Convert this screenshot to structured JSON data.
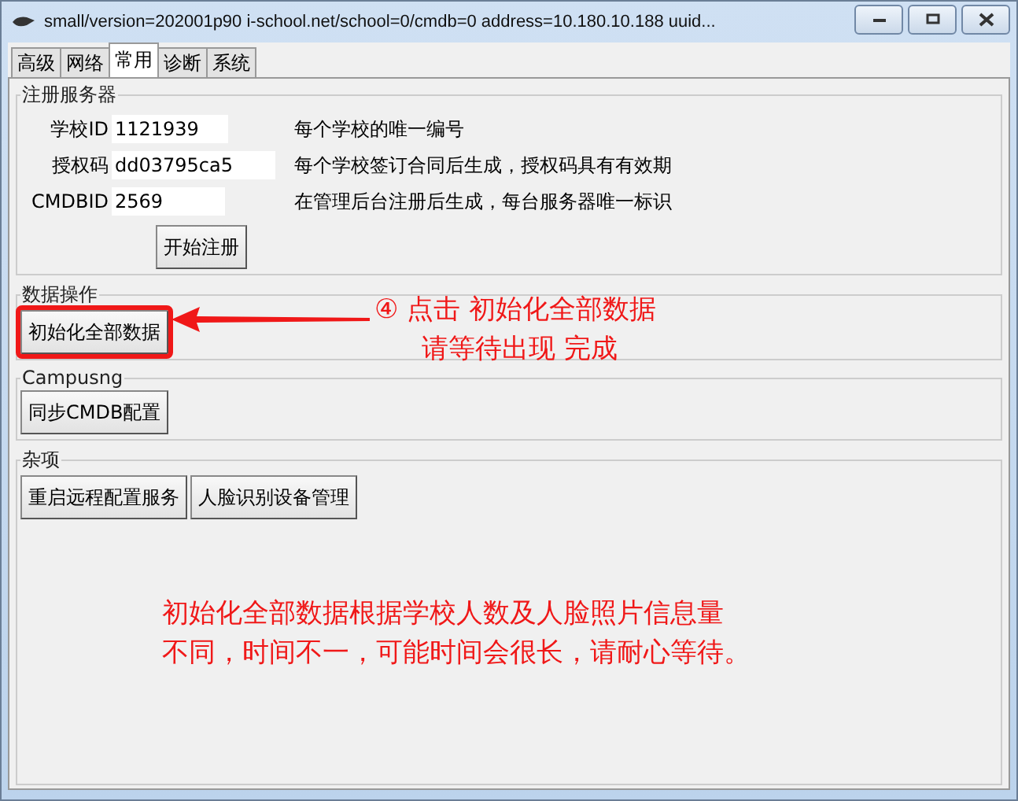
{
  "window": {
    "title": "small/version=202001p90 i-school.net/school=0/cmdb=0 address=10.180.10.188 uuid..."
  },
  "tabs": [
    {
      "label": "高级",
      "selected": false
    },
    {
      "label": "网络",
      "selected": false
    },
    {
      "label": "常用",
      "selected": true
    },
    {
      "label": "诊断",
      "selected": false
    },
    {
      "label": "系统",
      "selected": false
    }
  ],
  "register": {
    "title": "注册服务器",
    "fields": [
      {
        "label": "学校ID",
        "value": "1121939",
        "hint": "每个学校的唯一编号"
      },
      {
        "label": "授权码",
        "value": "dd03795ca5",
        "hint": "每个学校签订合同后生成，授权码具有有效期"
      },
      {
        "label": "CMDBID",
        "value": "2569",
        "hint": "在管理后台注册后生成，每台服务器唯一标识"
      }
    ],
    "button": "开始注册"
  },
  "groups": [
    {
      "title": "数据操作",
      "buttons": [
        {
          "label": "初始化全部数据",
          "highlighted": true
        }
      ]
    },
    {
      "title": "Campusng",
      "buttons": [
        {
          "label": "同步CMDB配置",
          "highlighted": false
        }
      ]
    },
    {
      "title": "杂项",
      "buttons": [
        {
          "label": "重启远程配置服务",
          "highlighted": false
        },
        {
          "label": "人脸识别设备管理",
          "highlighted": false
        }
      ]
    }
  ],
  "annotation": {
    "lines": [
      "④ 点击 初始化全部数据",
      "请等待出现 完成"
    ]
  },
  "note": {
    "lines": [
      "初始化全部数据根据学校人数及人脸照片信息量",
      "不同，时间不一，可能时间会很长，请耐心等待。"
    ]
  }
}
